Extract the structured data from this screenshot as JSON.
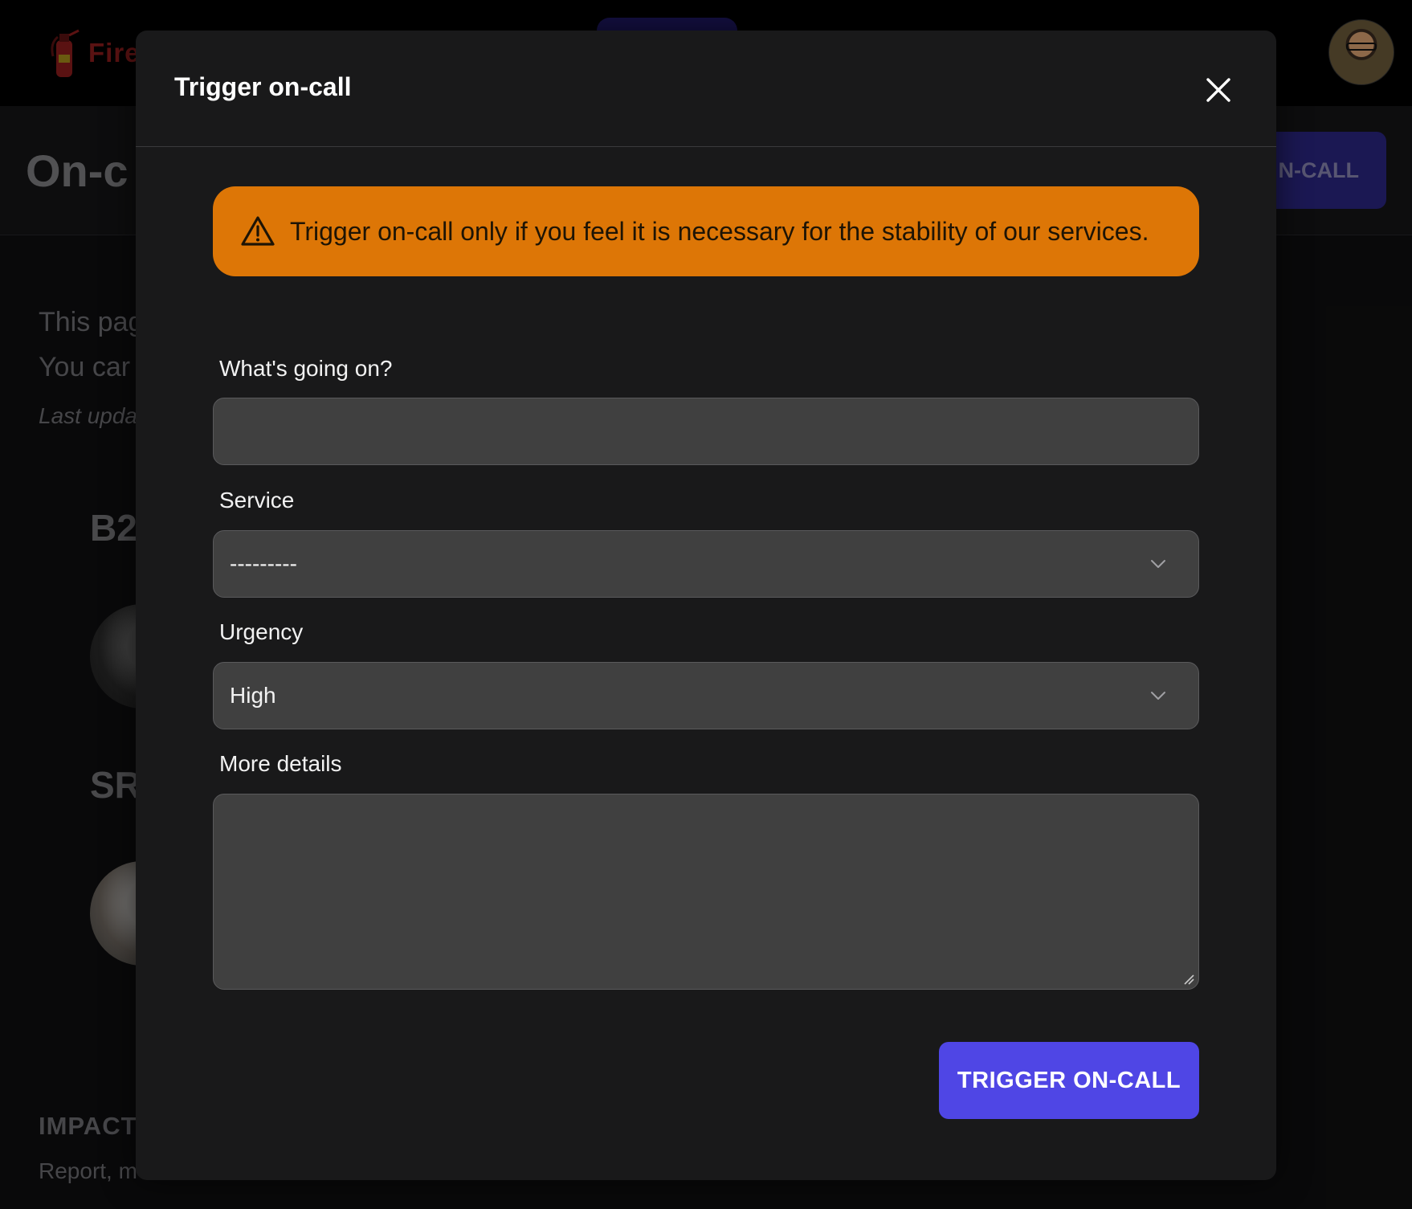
{
  "app": {
    "brand_name": "Fire"
  },
  "background": {
    "page_title": "On-c",
    "header_button_label": "N-CALL",
    "intro_line1": "This pag",
    "intro_line2": "You car",
    "last_updated": "Last upda",
    "section1_title": "B2",
    "section2_title": "SR",
    "impact_heading": "IMPACT",
    "impact_text": "Report, m"
  },
  "modal": {
    "title": "Trigger on-call",
    "warning_text": "Trigger on-call only if you feel it is necessary for the stability of our services.",
    "fields": {
      "whats_going_on": {
        "label": "What's going on?",
        "value": "",
        "placeholder": ""
      },
      "service": {
        "label": "Service",
        "selected": "---------"
      },
      "urgency": {
        "label": "Urgency",
        "selected": "High"
      },
      "more_details": {
        "label": "More details",
        "value": ""
      }
    },
    "submit_label": "TRIGGER ON-CALL"
  },
  "colors": {
    "warning_bg": "#dd7606",
    "primary_button": "#4f46e5",
    "modal_bg": "#19191a",
    "input_bg": "#404040"
  }
}
